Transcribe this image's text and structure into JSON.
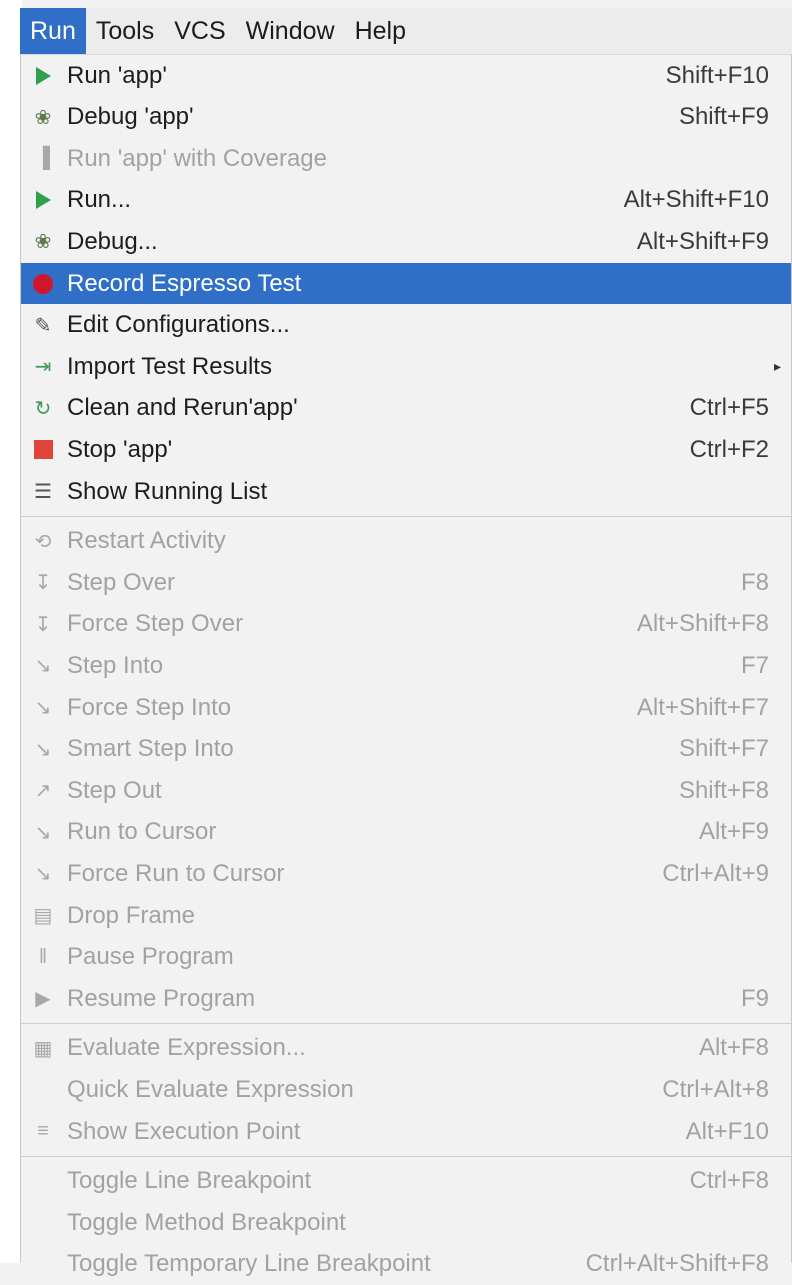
{
  "menubar": {
    "items": [
      "Run",
      "Tools",
      "VCS",
      "Window",
      "Help"
    ]
  },
  "menu": {
    "groups": [
      [
        {
          "label": "Run 'app'",
          "shortcut": "Shift+F10",
          "icon": "run-icon",
          "enabled": true
        },
        {
          "label": "Debug 'app'",
          "shortcut": "Shift+F9",
          "icon": "debug-icon",
          "enabled": true
        },
        {
          "label": "Run 'app' with Coverage",
          "shortcut": "",
          "icon": "coverage-icon",
          "enabled": false
        },
        {
          "label": "Run...",
          "shortcut": "Alt+Shift+F10",
          "icon": "play-icon",
          "enabled": true
        },
        {
          "label": "Debug...",
          "shortcut": "Alt+Shift+F9",
          "icon": "debug-icon",
          "enabled": true
        },
        {
          "label": "Record Espresso Test",
          "shortcut": "",
          "icon": "record-icon",
          "enabled": true,
          "selected": true
        },
        {
          "label": "Edit Configurations...",
          "shortcut": "",
          "icon": "edit-config-icon",
          "enabled": true
        },
        {
          "label": "Import Test Results",
          "shortcut": "",
          "icon": "import-icon",
          "enabled": true,
          "submenu": true
        },
        {
          "label": "Clean and Rerun'app'",
          "shortcut": "Ctrl+F5",
          "icon": "clean-rerun-icon",
          "enabled": true
        },
        {
          "label": "Stop 'app'",
          "shortcut": "Ctrl+F2",
          "icon": "stop-icon",
          "enabled": true
        },
        {
          "label": "Show Running List",
          "shortcut": "",
          "icon": "running-list-icon",
          "enabled": true
        }
      ],
      [
        {
          "label": "Restart Activity",
          "shortcut": "",
          "icon": "restart-icon",
          "enabled": false
        },
        {
          "label": "Step Over",
          "shortcut": "F8",
          "icon": "step-over-icon",
          "enabled": false
        },
        {
          "label": "Force Step Over",
          "shortcut": "Alt+Shift+F8",
          "icon": "force-step-over-icon",
          "enabled": false
        },
        {
          "label": "Step Into",
          "shortcut": "F7",
          "icon": "step-into-icon",
          "enabled": false
        },
        {
          "label": "Force Step Into",
          "shortcut": "Alt+Shift+F7",
          "icon": "force-step-into-icon",
          "enabled": false
        },
        {
          "label": "Smart Step Into",
          "shortcut": "Shift+F7",
          "icon": "smart-step-into-icon",
          "enabled": false
        },
        {
          "label": "Step Out",
          "shortcut": "Shift+F8",
          "icon": "step-out-icon",
          "enabled": false
        },
        {
          "label": "Run to Cursor",
          "shortcut": "Alt+F9",
          "icon": "run-to-cursor-icon",
          "enabled": false
        },
        {
          "label": "Force Run to Cursor",
          "shortcut": "Ctrl+Alt+9",
          "icon": "force-run-to-cursor-icon",
          "enabled": false
        },
        {
          "label": "Drop Frame",
          "shortcut": "",
          "icon": "drop-frame-icon",
          "enabled": false
        },
        {
          "label": "Pause Program",
          "shortcut": "",
          "icon": "pause-icon",
          "enabled": false
        },
        {
          "label": "Resume Program",
          "shortcut": "F9",
          "icon": "resume-icon",
          "enabled": false
        }
      ],
      [
        {
          "label": "Evaluate Expression...",
          "shortcut": "Alt+F8",
          "icon": "evaluate-icon",
          "enabled": false
        },
        {
          "label": "Quick Evaluate Expression",
          "shortcut": "Ctrl+Alt+8",
          "icon": "",
          "enabled": false
        },
        {
          "label": "Show Execution Point",
          "shortcut": "Alt+F10",
          "icon": "execution-point-icon",
          "enabled": false
        }
      ],
      [
        {
          "label": "Toggle Line Breakpoint",
          "shortcut": "Ctrl+F8",
          "icon": "",
          "enabled": false
        },
        {
          "label": "Toggle Method Breakpoint",
          "shortcut": "",
          "icon": "",
          "enabled": false
        },
        {
          "label": "Toggle Temporary Line Breakpoint",
          "shortcut": "Ctrl+Alt+Shift+F8",
          "icon": "",
          "enabled": false
        }
      ]
    ]
  },
  "colors": {
    "selection": "#2f6fc8",
    "run_green": "#31a04b",
    "record_red": "#d0172a",
    "stop_red": "#e0453b"
  }
}
